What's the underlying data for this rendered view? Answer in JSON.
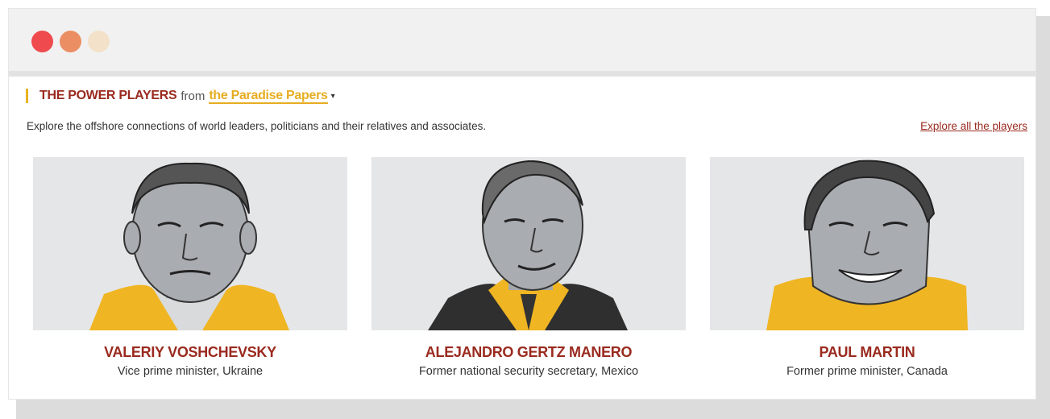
{
  "window": {
    "controls": [
      "close-dot",
      "minimize-dot",
      "maximize-dot"
    ],
    "colors": {
      "close": "#ef4a4d",
      "minimize": "#ec8e63",
      "maximize": "#f3e2c9"
    }
  },
  "header": {
    "title": "THE POWER PLAYERS",
    "from": "from",
    "source_link": "the Paradise Papers",
    "caret": "▾"
  },
  "intro": "Explore the offshore connections of world leaders, politicians and their relatives and associates.",
  "explore_link": "Explore all the players",
  "players": [
    {
      "name": "VALERIY VOSHCHEVSKY",
      "role": "Vice prime minister, Ukraine"
    },
    {
      "name": "ALEJANDRO GERTZ MANERO",
      "role": "Former national security secretary, Mexico"
    },
    {
      "name": "PAUL MARTIN",
      "role": "Former prime minister, Canada"
    }
  ],
  "colors": {
    "accent": "#9a2a1f",
    "highlight": "#e6ad22",
    "portrait_bg": "#e5e6e8"
  }
}
